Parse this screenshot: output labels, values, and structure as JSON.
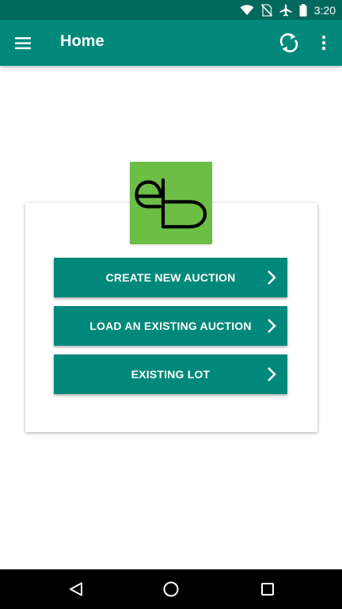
{
  "status_bar": {
    "time": "3:20",
    "icons": [
      "wifi-icon",
      "no-sim-icon",
      "airplane-mode-icon",
      "battery-icon"
    ]
  },
  "app_bar": {
    "title": "Home",
    "icons": [
      "menu-icon",
      "sync-icon",
      "more-vert-icon"
    ]
  },
  "logo": {
    "text": "eb",
    "colors": {
      "background": "#6cbe45",
      "stroke": "#000000"
    }
  },
  "actions": [
    {
      "label": "CREATE NEW AUCTION"
    },
    {
      "label": "LOAD AN EXISTING AUCTION"
    },
    {
      "label": "EXISTING LOT"
    }
  ],
  "nav_bar": {
    "icons": [
      "back-icon",
      "home-icon",
      "recents-icon"
    ]
  },
  "colors": {
    "status_bar": "#00695c",
    "app_bar": "#00897b",
    "button": "#00897b",
    "background": "#ffffff"
  }
}
